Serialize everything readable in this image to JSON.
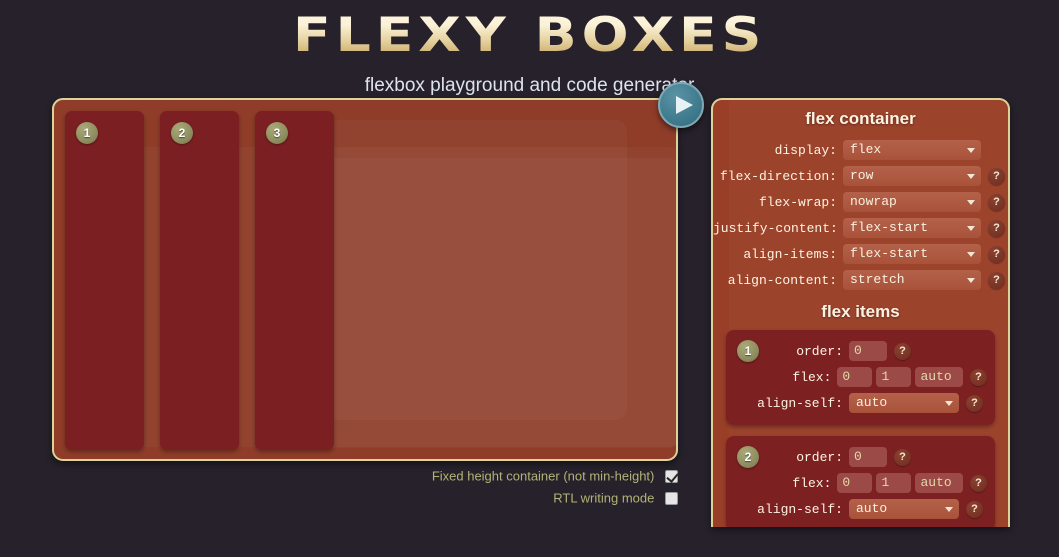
{
  "header": {
    "title": "FLEXY BOXES",
    "subtitle": "flexbox playground and code generator"
  },
  "colors": {
    "page_background": "#26212a",
    "container_background": "#8f3d29",
    "panel_background": "#9a3f27",
    "panel_border": "#ddd29a",
    "item_background": "#7b1f22",
    "badge": "#8f8e60",
    "play_button": "#417d90",
    "label_text": "#fdf3e2",
    "option_text": "#b4b277"
  },
  "preview": {
    "play_button_label": "play-icon",
    "items": [
      {
        "number": "1"
      },
      {
        "number": "2"
      },
      {
        "number": "3"
      }
    ],
    "options": [
      {
        "label": "Fixed height container (not min-height)",
        "checked": true
      },
      {
        "label": "RTL writing mode",
        "checked": false
      }
    ]
  },
  "controls": {
    "container_section_title": "flex container",
    "items_section_title": "flex items",
    "help_label": "?",
    "container_properties": [
      {
        "label": "display:",
        "value": "flex",
        "has_help": false
      },
      {
        "label": "flex-direction:",
        "value": "row",
        "has_help": true
      },
      {
        "label": "flex-wrap:",
        "value": "nowrap",
        "has_help": true
      },
      {
        "label": "justify-content:",
        "value": "flex-start",
        "has_help": true
      },
      {
        "label": "align-items:",
        "value": "flex-start",
        "has_help": true
      },
      {
        "label": "align-content:",
        "value": "stretch",
        "has_help": true
      }
    ],
    "item_cards": [
      {
        "number": "1",
        "order_label": "order:",
        "order_value": "0",
        "flex_label": "flex:",
        "flex_grow": "0",
        "flex_shrink": "1",
        "flex_basis": "auto",
        "align_self_label": "align-self:",
        "align_self_value": "auto"
      },
      {
        "number": "2",
        "order_label": "order:",
        "order_value": "0",
        "flex_label": "flex:",
        "flex_grow": "0",
        "flex_shrink": "1",
        "flex_basis": "auto",
        "align_self_label": "align-self:",
        "align_self_value": "auto"
      }
    ]
  }
}
